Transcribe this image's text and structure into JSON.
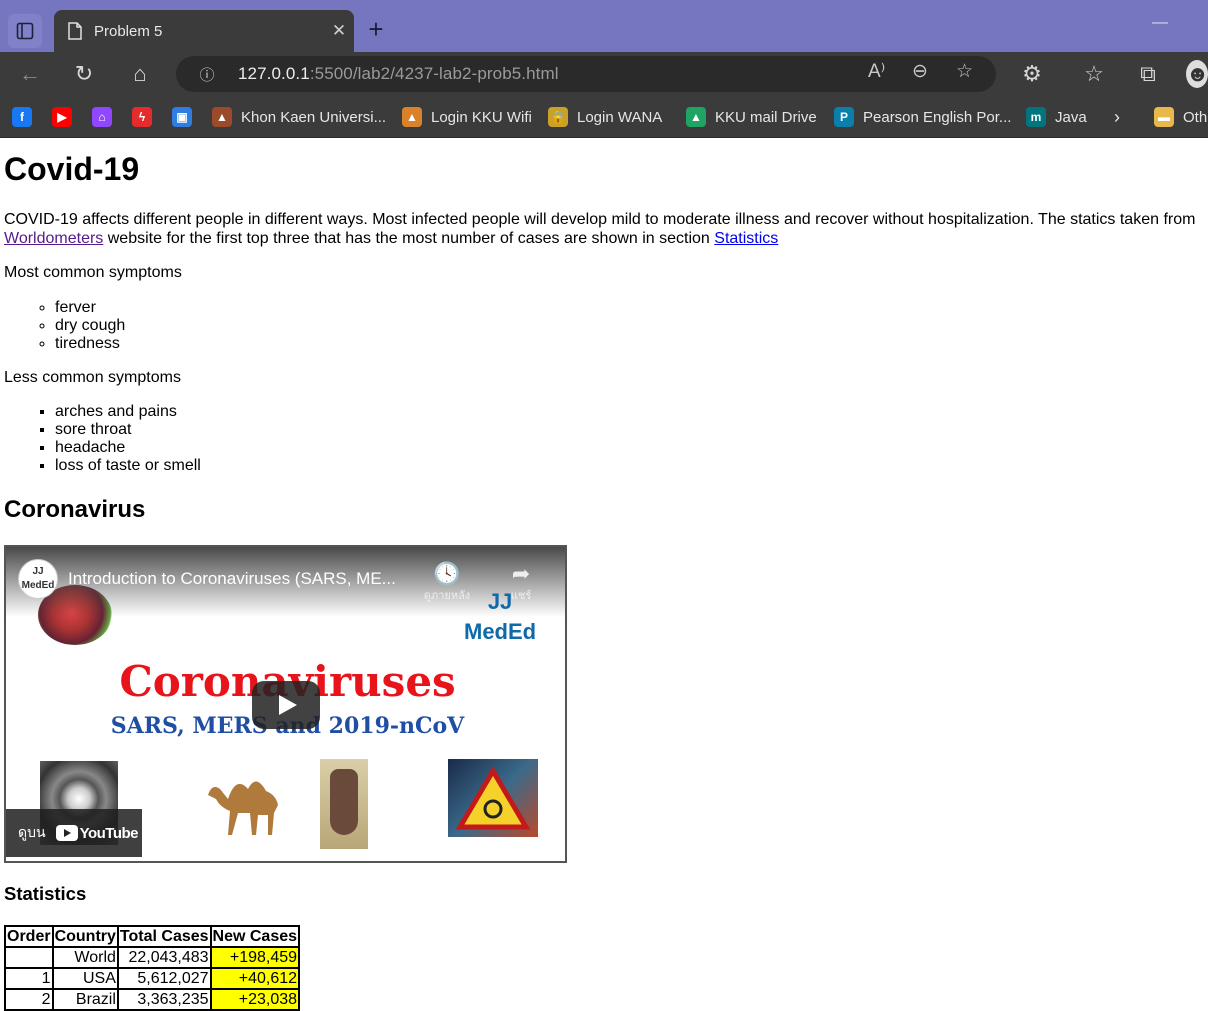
{
  "browser": {
    "tab_title": "Problem 5",
    "tab_close": "✕",
    "new_tab": "+",
    "url_host": "127.0.0.1",
    "url_rest": ":5500/lab2/4237-lab2-prob5.html",
    "bookmarks": [
      {
        "label": "",
        "icon": "facebook-icon",
        "color": "#1877f2",
        "glyph": "f"
      },
      {
        "label": "",
        "icon": "youtube-icon",
        "color": "#ff0000",
        "glyph": "▶"
      },
      {
        "label": "",
        "icon": "twitch-icon",
        "color": "#9146ff",
        "glyph": "⌂"
      },
      {
        "label": "",
        "icon": "flash-icon",
        "color": "#e52b2b",
        "glyph": "ϟ"
      },
      {
        "label": "",
        "icon": "contact-icon",
        "color": "#2f7de1",
        "glyph": "▣"
      },
      {
        "label": "Khon Kaen Universi...",
        "icon": "kku-icon",
        "color": "#9b4a2a",
        "glyph": "▲"
      },
      {
        "label": "Login KKU Wifi",
        "icon": "kku-wifi-icon",
        "color": "#d9822b",
        "glyph": "▲"
      },
      {
        "label": "Login WANA",
        "icon": "lock-icon",
        "color": "#c9a227",
        "glyph": "🔒"
      },
      {
        "label": "KKU mail Drive",
        "icon": "google-drive-icon",
        "color": "#1fa463",
        "glyph": "▲"
      },
      {
        "label": "Pearson English Por...",
        "icon": "pearson-icon",
        "color": "#0b7fab",
        "glyph": "P"
      },
      {
        "label": "Java",
        "icon": "java-icon",
        "color": "#00757f",
        "glyph": "m"
      },
      {
        "label": "Oth",
        "icon": "folder-icon",
        "color": "#e8b84a",
        "glyph": "▬"
      }
    ]
  },
  "page": {
    "title": "Covid-19",
    "intro_before": "COVID-19 affects different people in different ways. Most infected people will develop mild to moderate illness and recover without hospitalization. The statics taken from ",
    "intro_link1": "Worldometers",
    "intro_middle": " website for the first top three that has the most number of cases are shown in section ",
    "intro_link2": "Statistics",
    "common_label": "Most common symptoms",
    "common_symptoms": [
      "ferver",
      "dry cough",
      "tiredness"
    ],
    "less_label": "Less common symptoms",
    "less_symptoms": [
      "arches and pains",
      "sore throat",
      "headache",
      "loss of taste or smell"
    ],
    "video_heading": "Coronavirus",
    "video": {
      "channel_badge": "JJ MedEd",
      "title": "Introduction to Coronaviruses (SARS, ME...",
      "watch_later": "ดูภายหลัง",
      "share": "แชร์",
      "brand_line1": "JJ",
      "brand_line2": "MedEd",
      "headline": "Coronaviruses",
      "subline": "SARS, MERS and 2019-nCoV",
      "watch_on": "ดูบน",
      "youtube": "YouTube"
    },
    "stats_heading": "Statistics",
    "table": {
      "headers": [
        "Order",
        "Country",
        "Total Cases",
        "New Cases"
      ],
      "rows": [
        [
          "",
          "World",
          "22,043,483",
          "+198,459"
        ],
        [
          "1",
          "USA",
          "5,612,027",
          "+40,612"
        ],
        [
          "2",
          "Brazil",
          "3,363,235",
          "+23,038"
        ]
      ],
      "highlight_color": "#ffff00"
    }
  }
}
